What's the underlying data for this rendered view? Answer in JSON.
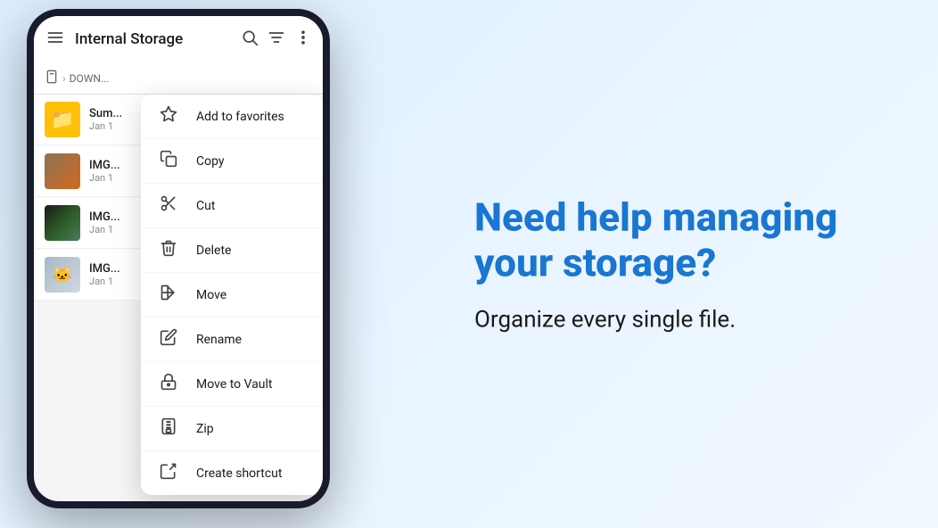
{
  "app": {
    "title": "Internal Storage",
    "breadcrumb": "DOWN..."
  },
  "toolbar": {
    "menu_icon": "≡",
    "search_icon": "⌕",
    "sort_icon": "⇅",
    "more_icon": "⋮"
  },
  "files": [
    {
      "id": "folder1",
      "name": "Sum...",
      "date": "Jan 1",
      "type": "folder"
    },
    {
      "id": "img1",
      "name": "IMG...",
      "date": "Jan 1",
      "type": "img1"
    },
    {
      "id": "img2",
      "name": "IMG...",
      "date": "Jan 1",
      "type": "img2"
    },
    {
      "id": "img3",
      "name": "IMG...",
      "date": "Jan 1",
      "type": "img3"
    }
  ],
  "context_menu": {
    "items": [
      {
        "id": "add-to-favorites",
        "label": "Add to favorites",
        "icon": "star"
      },
      {
        "id": "copy",
        "label": "Copy",
        "icon": "copy"
      },
      {
        "id": "cut",
        "label": "Cut",
        "icon": "scissors"
      },
      {
        "id": "delete",
        "label": "Delete",
        "icon": "trash"
      },
      {
        "id": "move",
        "label": "Move",
        "icon": "move"
      },
      {
        "id": "rename",
        "label": "Rename",
        "icon": "edit"
      },
      {
        "id": "move-to-vault",
        "label": "Move to Vault",
        "icon": "lock"
      },
      {
        "id": "zip",
        "label": "Zip",
        "icon": "zip"
      },
      {
        "id": "create-shortcut",
        "label": "Create shortcut",
        "icon": "shortcut"
      }
    ]
  },
  "promo": {
    "headline": "Need help managing your storage?",
    "subtext": "Organize every single file."
  }
}
